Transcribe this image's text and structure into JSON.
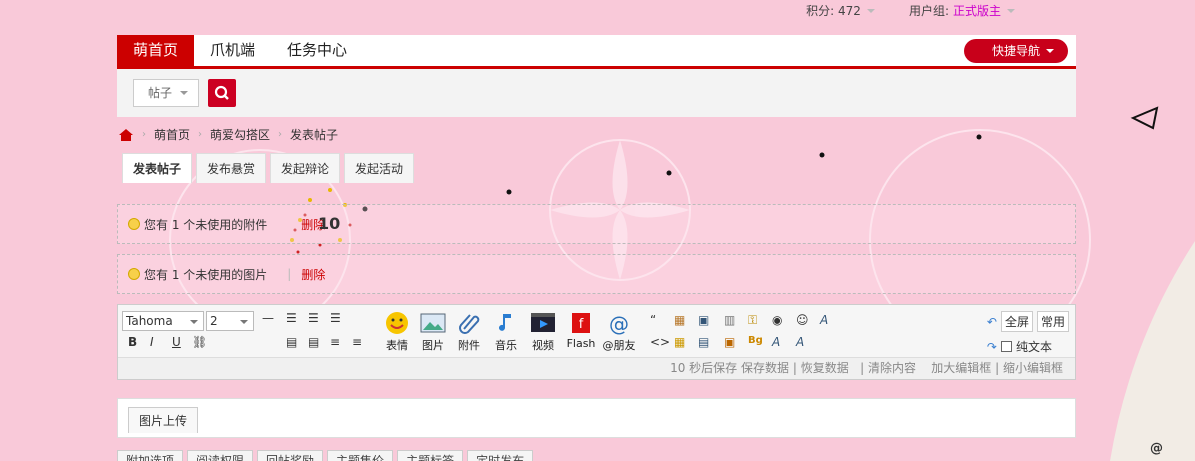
{
  "topbar": {
    "points_label": "积分: 472",
    "usergroup_label": "用户组:",
    "usergroup_value": "正式版主"
  },
  "nav": {
    "items": [
      "萌首页",
      "爪机端",
      "任务中心"
    ],
    "quick_nav": "快捷导航"
  },
  "search": {
    "type_label": "帖子"
  },
  "breadcrumb": [
    "萌首页",
    "萌爱勾搭区",
    "发表帖子"
  ],
  "tabs": [
    "发表帖子",
    "发布悬赏",
    "发起辩论",
    "发起活动"
  ],
  "notices": [
    {
      "text": "您有 1 个未使用的附件",
      "action": "删除"
    },
    {
      "text": "您有 1 个未使用的图片",
      "action": "删除"
    }
  ],
  "overlay_counter": "10",
  "editor": {
    "font": "Tahoma",
    "size": "2",
    "tools": [
      "表情",
      "图片",
      "附件",
      "音乐",
      "视频",
      "Flash",
      "@朋友"
    ],
    "fullscreen": "全屏",
    "common": "常用",
    "plain_text": "纯文本",
    "status_items": [
      "10 秒后保存",
      "保存数据",
      "恢复数据",
      "清除内容",
      "加大编辑框",
      "缩小编辑框"
    ]
  },
  "upload": {
    "tab_label": "图片上传"
  },
  "bottom_tabs": [
    "附加选项",
    "阅读权限",
    "回帖奖励",
    "主题售价",
    "主题标签",
    "定时发布"
  ],
  "colors": {
    "accent": "#cc0000",
    "background": "#f9c9d9"
  }
}
